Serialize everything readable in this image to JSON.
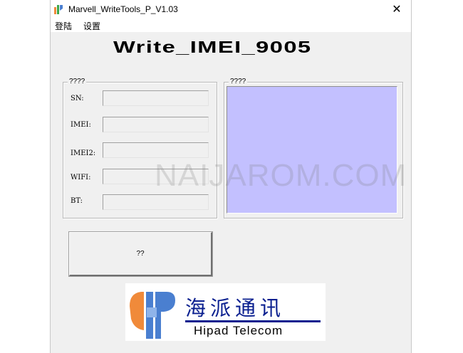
{
  "window": {
    "title": "Marvell_WriteTools_P_V1.03",
    "close_glyph": "✕"
  },
  "menu": {
    "items": [
      "登陆",
      "设置"
    ]
  },
  "heading": "Write_IMEI_9005",
  "input_group": {
    "legend": "????",
    "fields": [
      {
        "label": "SN:",
        "value": ""
      },
      {
        "label": "IMEI:",
        "value": ""
      },
      {
        "label": "IMEI2:",
        "value": ""
      },
      {
        "label": "WIFI:",
        "value": ""
      },
      {
        "label": "BT:",
        "value": ""
      }
    ]
  },
  "display_group": {
    "legend": "????",
    "panel_color": "#c3c0ff"
  },
  "main_button": {
    "label": "??"
  },
  "logo": {
    "cn_text": "海派通讯",
    "en_text": "Hipad Telecom",
    "brand_color": "#0a1f8f",
    "accent_orange": "#f08a3a",
    "accent_blue": "#4a7fd0"
  },
  "watermark": "NAIJAROM.COM"
}
